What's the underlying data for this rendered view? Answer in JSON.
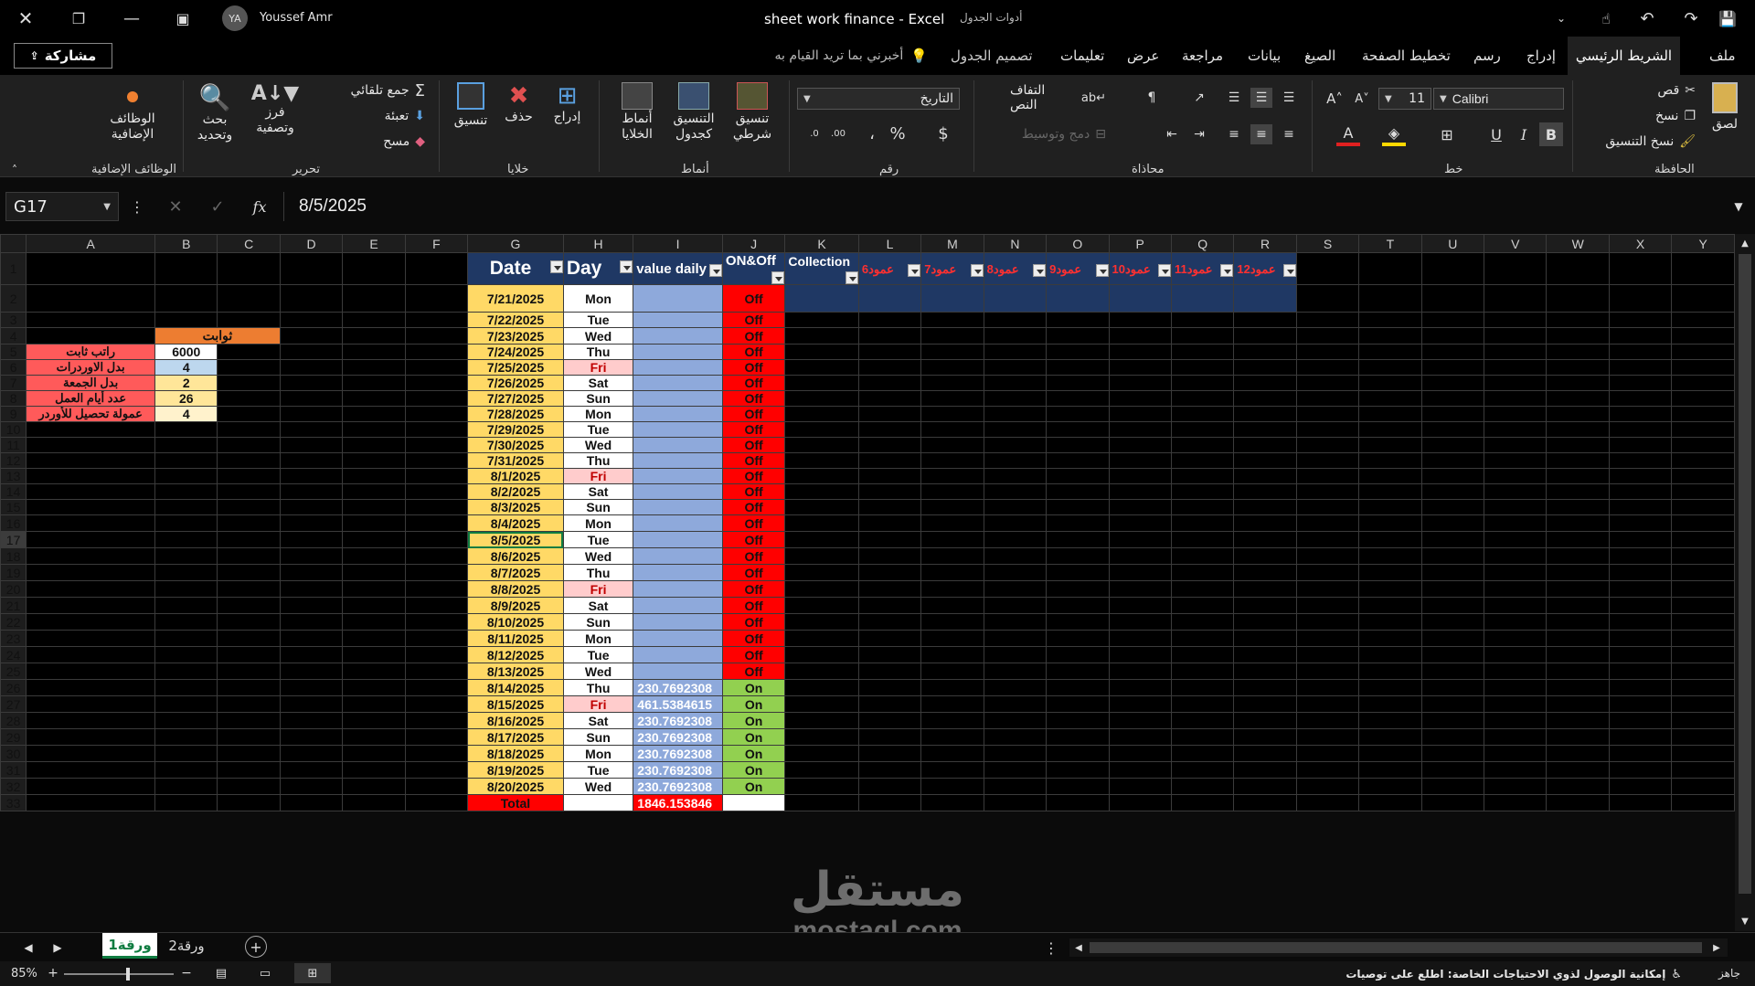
{
  "title_bar": {
    "user_initials": "YA",
    "user_name": "Youssef Amr",
    "doc_title": "sheet work finance  -  Excel",
    "context_tool": "أدوات الجدول"
  },
  "tabs": {
    "file": "ملف",
    "home": "الشريط الرئيسي",
    "insert": "إدراج",
    "draw": "رسم",
    "layout": "تخطيط الصفحة",
    "formulas": "الصيغ",
    "data": "بيانات",
    "review": "مراجعة",
    "view": "عرض",
    "help": "تعليمات",
    "table_design": "تصميم الجدول",
    "tell_me": "أخبرني بما تريد القيام به",
    "share": "مشاركة"
  },
  "ribbon": {
    "clipboard": {
      "group": "الحافظة",
      "paste": "لصق",
      "cut": "قص",
      "copy": "نسخ",
      "format_painter": "نسخ التنسيق"
    },
    "font": {
      "group": "خط",
      "name": "Calibri",
      "size": "11",
      "bold": "B",
      "italic": "I",
      "underline": "U"
    },
    "alignment": {
      "group": "محاذاة",
      "wrap": "التفاف النص",
      "merge": "دمج وتوسيط"
    },
    "number": {
      "group": "رقم",
      "format": "التاريخ",
      "currency": "$",
      "percent": "%",
      "comma": "،"
    },
    "styles": {
      "group": "أنماط",
      "conditional": "تنسيق شرطي",
      "as_table": "التنسيق كجدول",
      "cell_styles": "أنماط الخلايا"
    },
    "cells": {
      "group": "خلايا",
      "insert": "إدراج",
      "delete": "حذف",
      "format": "تنسيق"
    },
    "editing": {
      "group": "تحرير",
      "autosum": "جمع تلقائي",
      "fill": "تعبئة",
      "clear": "مسح",
      "sort": "فرز وتصفية",
      "find": "بحث وتحديد"
    },
    "addins": {
      "group": "الوظائف الإضافية",
      "label": "الوظائف الإضافية"
    }
  },
  "formula_bar": {
    "name_box": "G17",
    "fx": "fx",
    "value": "8/5/2025"
  },
  "columns": [
    "A",
    "B",
    "C",
    "D",
    "E",
    "F",
    "G",
    "H",
    "I",
    "J",
    "K",
    "L",
    "M",
    "N",
    "O",
    "P",
    "Q",
    "R",
    "S",
    "T",
    "U",
    "V",
    "W",
    "X",
    "Y"
  ],
  "constants": {
    "header": "ثوابت",
    "rows": [
      {
        "label": "راتب ثابت",
        "value": "6000"
      },
      {
        "label": "بدل الاوردرات",
        "value": "4"
      },
      {
        "label": "بدل الجمعة",
        "value": "2"
      },
      {
        "label": "عدد أيام العمل",
        "value": "26"
      },
      {
        "label": "عمولة تحصيل للأوردر",
        "value": "4"
      }
    ]
  },
  "table": {
    "headers": [
      "Date",
      "Day",
      "value daily",
      "ON&Off",
      "Collection",
      "عمود6",
      "عمود7",
      "عمود8",
      "عمود9",
      "عمود10",
      "عمود11",
      "عمود12"
    ],
    "rows": [
      {
        "date": "7/21/2025",
        "day": "Mon",
        "value": "",
        "status": "Off"
      },
      {
        "date": "7/22/2025",
        "day": "Tue",
        "value": "",
        "status": "Off"
      },
      {
        "date": "7/23/2025",
        "day": "Wed",
        "value": "",
        "status": "Off"
      },
      {
        "date": "7/24/2025",
        "day": "Thu",
        "value": "",
        "status": "Off"
      },
      {
        "date": "7/25/2025",
        "day": "Fri",
        "value": "",
        "status": "Off"
      },
      {
        "date": "7/26/2025",
        "day": "Sat",
        "value": "",
        "status": "Off"
      },
      {
        "date": "7/27/2025",
        "day": "Sun",
        "value": "",
        "status": "Off"
      },
      {
        "date": "7/28/2025",
        "day": "Mon",
        "value": "",
        "status": "Off"
      },
      {
        "date": "7/29/2025",
        "day": "Tue",
        "value": "",
        "status": "Off"
      },
      {
        "date": "7/30/2025",
        "day": "Wed",
        "value": "",
        "status": "Off"
      },
      {
        "date": "7/31/2025",
        "day": "Thu",
        "value": "",
        "status": "Off"
      },
      {
        "date": "8/1/2025",
        "day": "Fri",
        "value": "",
        "status": "Off"
      },
      {
        "date": "8/2/2025",
        "day": "Sat",
        "value": "",
        "status": "Off"
      },
      {
        "date": "8/3/2025",
        "day": "Sun",
        "value": "",
        "status": "Off"
      },
      {
        "date": "8/4/2025",
        "day": "Mon",
        "value": "",
        "status": "Off"
      },
      {
        "date": "8/5/2025",
        "day": "Tue",
        "value": "",
        "status": "Off"
      },
      {
        "date": "8/6/2025",
        "day": "Wed",
        "value": "",
        "status": "Off"
      },
      {
        "date": "8/7/2025",
        "day": "Thu",
        "value": "",
        "status": "Off"
      },
      {
        "date": "8/8/2025",
        "day": "Fri",
        "value": "",
        "status": "Off"
      },
      {
        "date": "8/9/2025",
        "day": "Sat",
        "value": "",
        "status": "Off"
      },
      {
        "date": "8/10/2025",
        "day": "Sun",
        "value": "",
        "status": "Off"
      },
      {
        "date": "8/11/2025",
        "day": "Mon",
        "value": "",
        "status": "Off"
      },
      {
        "date": "8/12/2025",
        "day": "Tue",
        "value": "",
        "status": "Off"
      },
      {
        "date": "8/13/2025",
        "day": "Wed",
        "value": "",
        "status": "Off"
      },
      {
        "date": "8/14/2025",
        "day": "Thu",
        "value": "230.7692308",
        "status": "On"
      },
      {
        "date": "8/15/2025",
        "day": "Fri",
        "value": "461.5384615",
        "status": "On"
      },
      {
        "date": "8/16/2025",
        "day": "Sat",
        "value": "230.7692308",
        "status": "On"
      },
      {
        "date": "8/17/2025",
        "day": "Sun",
        "value": "230.7692308",
        "status": "On"
      },
      {
        "date": "8/18/2025",
        "day": "Mon",
        "value": "230.7692308",
        "status": "On"
      },
      {
        "date": "8/19/2025",
        "day": "Tue",
        "value": "230.7692308",
        "status": "On"
      },
      {
        "date": "8/20/2025",
        "day": "Wed",
        "value": "230.7692308",
        "status": "On"
      }
    ],
    "total_label": "Total",
    "total_value": "1846.153846"
  },
  "sheets": {
    "active": "ورقة1",
    "other": "ورقة2"
  },
  "status": {
    "ready": "جاهز",
    "accessibility": "إمكانية الوصول لذوي الاحتياجات الخاصة: اطلع على توصيات",
    "zoom": "85%"
  },
  "watermark": {
    "top": "مستقل",
    "bottom": "mostaql.com"
  },
  "colors": {
    "header_navy": "#1f3864",
    "date_yellow": "#ffd966",
    "value_blue": "#8ea9db",
    "off_red": "#ff0000",
    "on_green": "#92d050"
  }
}
